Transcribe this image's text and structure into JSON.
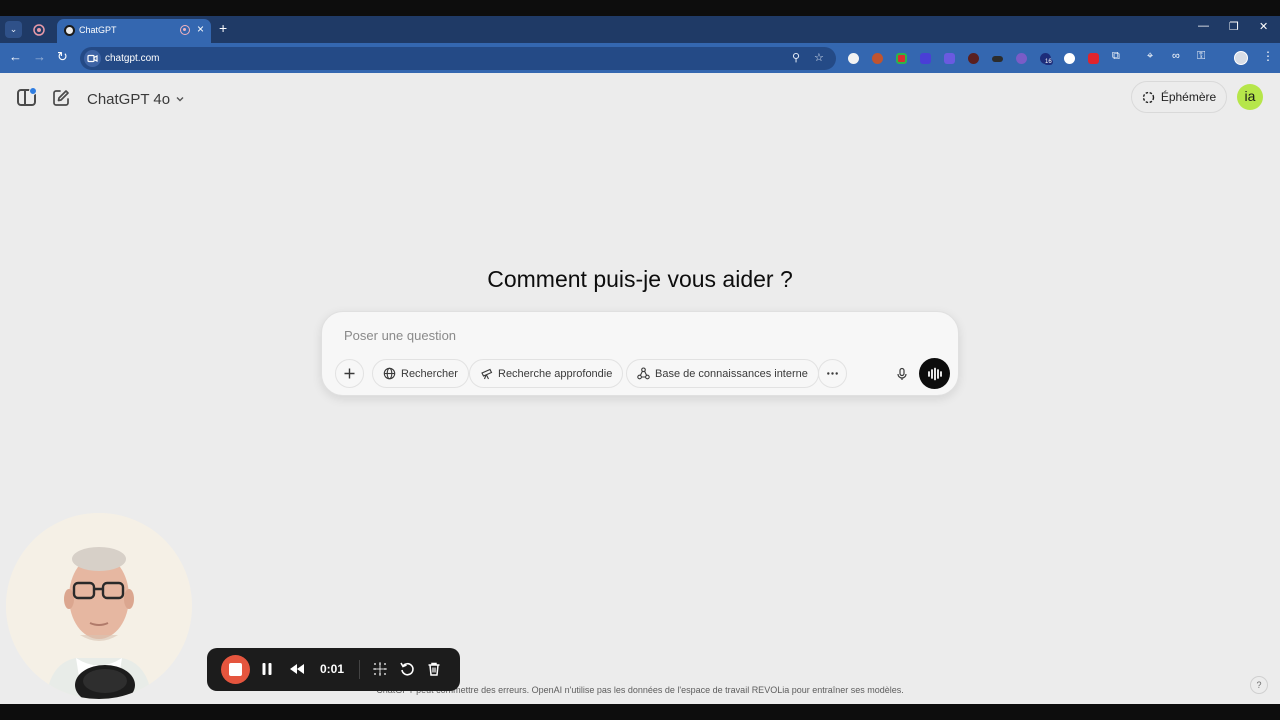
{
  "browser": {
    "tab_title": "ChatGPT",
    "url": "chatgpt.com",
    "window_controls": {
      "minimize": "—",
      "restore": "❐",
      "close": "✕"
    },
    "extension_badge": "16"
  },
  "header": {
    "model_name": "ChatGPT 4o",
    "ephemeral_label": "Éphémère",
    "user_initials": "ia"
  },
  "main": {
    "headline": "Comment puis-je vous aider ?",
    "composer": {
      "placeholder": "Poser une question",
      "tools": {
        "search": "Rechercher",
        "deep_research": "Recherche approfondie",
        "knowledge_base": "Base de connaissances interne"
      }
    }
  },
  "footer": {
    "disclaimer": "ChatGPT peut commettre des erreurs. OpenAI n'utilise pas les données de l'espace de travail REVOLia pour entraîner ses modèles.",
    "help": "?"
  },
  "recorder": {
    "time": "0:01"
  },
  "colors": {
    "tab_strip": "#1f3a66",
    "address_bar": "#3467b0",
    "page_bg": "#ececec",
    "avatar_bg": "#b6e64a",
    "record_stop": "#e5553e"
  }
}
